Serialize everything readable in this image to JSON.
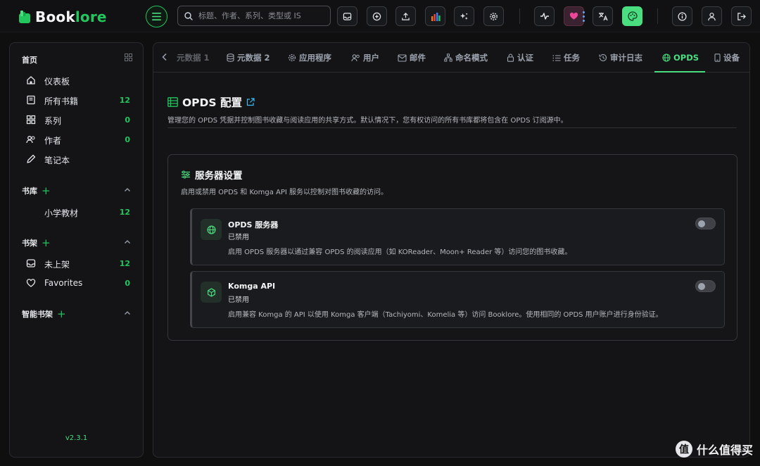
{
  "app": {
    "name_part1": "Book",
    "name_part2": "lore",
    "search_placeholder": "标题、作者、系列、类型或 IS"
  },
  "topbar": {
    "buttons": [
      "inbox-icon",
      "plus-circle-icon",
      "upload-icon",
      "chart-icon",
      "sparkles-icon",
      "gear-icon",
      "activity-icon",
      "heart-icon",
      "translate-icon",
      "palette-icon",
      "info-icon",
      "user-icon",
      "logout-icon"
    ]
  },
  "sidebar": {
    "home_title": "首页",
    "home_items": [
      {
        "label": "仪表板",
        "icon": "home-icon",
        "count": ""
      },
      {
        "label": "所有书籍",
        "icon": "book-icon",
        "count": "12"
      },
      {
        "label": "系列",
        "icon": "series-icon",
        "count": "0"
      },
      {
        "label": "作者",
        "icon": "authors-icon",
        "count": "0"
      },
      {
        "label": "笔记本",
        "icon": "pencil-icon",
        "count": ""
      }
    ],
    "library_title": "书库",
    "library_items": [
      {
        "label": "小学教材",
        "count": "12"
      }
    ],
    "shelf_title": "书架",
    "shelf_items": [
      {
        "label": "未上架",
        "icon": "inbox-icon",
        "count": "12"
      },
      {
        "label": "Favorites",
        "icon": "heart-icon",
        "count": "0"
      }
    ],
    "smart_shelf_title": "智能书架",
    "version": "v2.3.1"
  },
  "tabs": [
    {
      "label": "元数据 1",
      "icon": "",
      "state": "faded"
    },
    {
      "label": "元数据 2",
      "icon": "database-icon",
      "state": "normal"
    },
    {
      "label": "应用程序",
      "icon": "gear-icon",
      "state": "normal"
    },
    {
      "label": "用户",
      "icon": "users-icon",
      "state": "normal"
    },
    {
      "label": "邮件",
      "icon": "mail-icon",
      "state": "normal"
    },
    {
      "label": "命名模式",
      "icon": "sitemap-icon",
      "state": "normal"
    },
    {
      "label": "认证",
      "icon": "lock-icon",
      "state": "normal"
    },
    {
      "label": "任务",
      "icon": "list-icon",
      "state": "normal"
    },
    {
      "label": "审计日志",
      "icon": "history-icon",
      "state": "normal"
    },
    {
      "label": "OPDS",
      "icon": "globe-icon",
      "state": "active"
    },
    {
      "label": "设备",
      "icon": "device-icon",
      "state": "normal"
    }
  ],
  "page": {
    "title": "OPDS 配置",
    "description": "管理您的 OPDS 凭据并控制图书收藏与阅读应用的共享方式。默认情况下，您有权访问的所有书库都将包含在 OPDS 订阅源中。"
  },
  "server_settings": {
    "title": "服务器设置",
    "description": "启用或禁用 OPDS 和 Komga API 服务以控制对图书收藏的访问。",
    "services": [
      {
        "name": "OPDS 服务器",
        "status": "已禁用",
        "description": "启用 OPDS 服务器以通过兼容 OPDS 的阅读应用（如 KOReader、Moon+ Reader 等）访问您的图书收藏。",
        "icon": "globe-icon",
        "enabled": false
      },
      {
        "name": "Komga API",
        "status": "已禁用",
        "description": "启用兼容 Komga 的 API 以使用 Komga 客户端（Tachiyomi、Komelia 等）访问 Booklore。使用相同的 OPDS 用户账户进行身份验证。",
        "icon": "cube-icon",
        "enabled": false
      }
    ]
  },
  "watermark": {
    "symbol": "值",
    "text": "什么值得买"
  },
  "colors": {
    "accent": "#22c55e",
    "accent_light": "#4ade80",
    "background": "#0f0f10",
    "panel": "#141416"
  }
}
